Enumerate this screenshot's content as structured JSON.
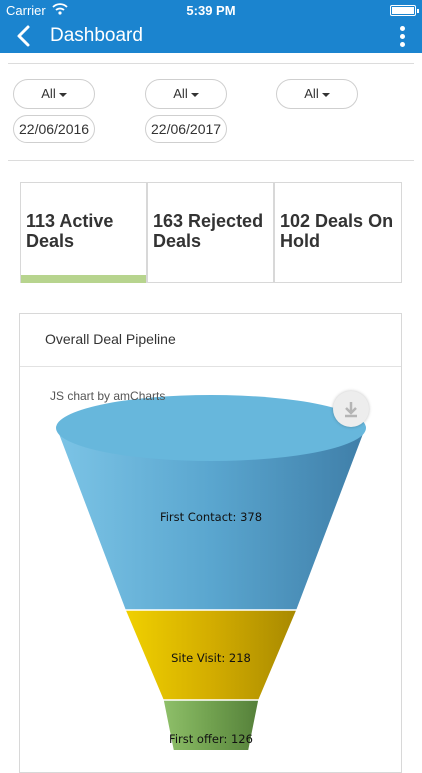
{
  "status_bar": {
    "carrier": "Carrier",
    "time": "5:39 PM"
  },
  "nav": {
    "title": "Dashboard"
  },
  "filters": [
    {
      "label": "All"
    },
    {
      "label": "All"
    },
    {
      "label": "All"
    }
  ],
  "dates": {
    "from": "22/06/2016",
    "to": "22/06/2017"
  },
  "cards": [
    {
      "line1": "113 Active",
      "line2": "Deals",
      "selected": true
    },
    {
      "line1": "163 Rejected",
      "line2": "Deals",
      "selected": false
    },
    {
      "line1": "102 Deals On",
      "line2": "Hold",
      "selected": false
    }
  ],
  "pipeline": {
    "title": "Overall Deal Pipeline",
    "credit": "JS chart by amCharts"
  },
  "colors": {
    "brand": "#1b84cf",
    "active_bar": "#b7d48e"
  },
  "chart_data": {
    "type": "funnel",
    "categories": [
      "First Contact",
      "Site Visit",
      "First offer"
    ],
    "values": [
      378,
      218,
      126
    ],
    "labels": [
      "First Contact: 378",
      "Site Visit: 218",
      "First offer: 126"
    ],
    "colors": [
      "#67b7dc",
      "#fdd400",
      "#84b761"
    ]
  }
}
